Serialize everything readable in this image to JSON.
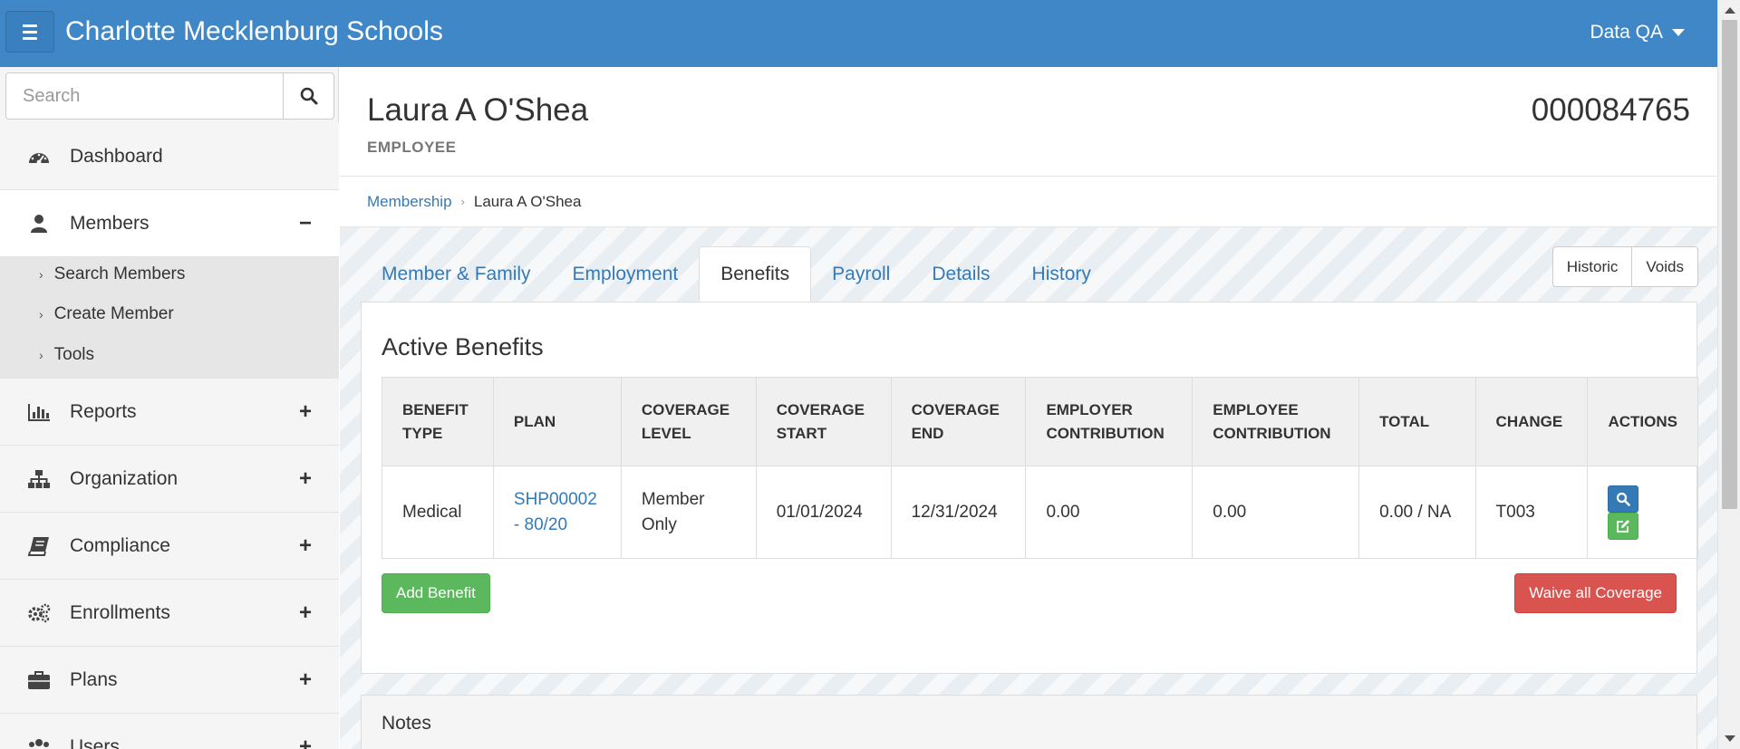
{
  "app": {
    "title": "Charlotte Mecklenburg Schools",
    "user": "Data QA"
  },
  "sidebar": {
    "search_placeholder": "Search",
    "items": [
      {
        "label": "Dashboard",
        "toggle": ""
      },
      {
        "label": "Members",
        "toggle": "−"
      },
      {
        "label": "Reports",
        "toggle": "+"
      },
      {
        "label": "Organization",
        "toggle": "+"
      },
      {
        "label": "Compliance",
        "toggle": "+"
      },
      {
        "label": "Enrollments",
        "toggle": "+"
      },
      {
        "label": "Plans",
        "toggle": "+"
      },
      {
        "label": "Users",
        "toggle": "+"
      }
    ],
    "members_subitems": [
      "Search Members",
      "Create Member",
      "Tools"
    ]
  },
  "member": {
    "name": "Laura A O'Shea",
    "type": "EMPLOYEE",
    "id": "000084765"
  },
  "breadcrumb": {
    "parent": "Membership",
    "current": "Laura A O'Shea"
  },
  "tabs": [
    "Member & Family",
    "Employment",
    "Benefits",
    "Payroll",
    "Details",
    "History"
  ],
  "active_tab": "Benefits",
  "view_buttons": [
    "Historic",
    "Voids"
  ],
  "benefits": {
    "title": "Active Benefits",
    "columns": [
      "BENEFIT TYPE",
      "PLAN",
      "COVERAGE LEVEL",
      "COVERAGE START",
      "COVERAGE END",
      "EMPLOYER CONTRIBUTION",
      "EMPLOYEE CONTRIBUTION",
      "TOTAL",
      "CHANGE",
      "ACTIONS"
    ],
    "rows": [
      {
        "benefit_type": "Medical",
        "plan": "SHP00002 - 80/20",
        "coverage_level": "Member Only",
        "coverage_start": "01/01/2024",
        "coverage_end": "12/31/2024",
        "employer_contribution": "0.00",
        "employee_contribution": "0.00",
        "total": "0.00 / NA",
        "change": "T003"
      }
    ],
    "add_label": "Add Benefit",
    "waive_label": "Waive all Coverage"
  },
  "notes": {
    "title": "Notes"
  },
  "colors": {
    "navbar": "#3f87c6",
    "link": "#337ab7",
    "success": "#5cb85c",
    "danger": "#d9534f"
  },
  "icons": {
    "menu": "hamburger-icon",
    "search": "search-icon",
    "caret": "caret-down-icon"
  }
}
